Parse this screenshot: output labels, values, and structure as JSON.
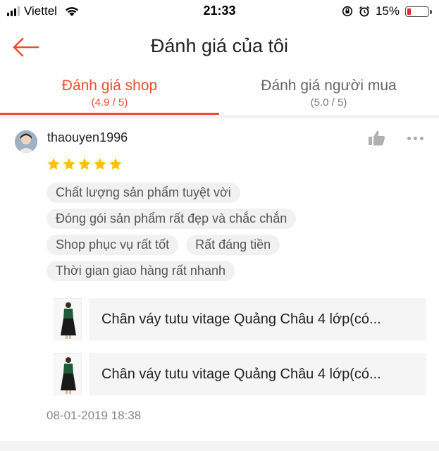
{
  "status_bar": {
    "carrier": "Viettel",
    "time": "21:33",
    "battery_percent": "15%",
    "battery_level": 0.15,
    "icons": [
      "signal-icon",
      "wifi-icon",
      "rotation-lock-icon",
      "alarm-icon",
      "battery-icon"
    ]
  },
  "nav": {
    "title": "Đánh giá của tôi",
    "back_icon": "back-arrow-icon"
  },
  "tabs": [
    {
      "label": "Đánh giá shop",
      "rating": "(4.9 / 5)",
      "active": true
    },
    {
      "label": "Đánh giá người mua",
      "rating": "(5.0 / 5)",
      "active": false
    }
  ],
  "review": {
    "username": "thaouyen1996",
    "stars": 5,
    "tags": [
      [
        "Chất lượng sản phẩm tuyệt vời"
      ],
      [
        "Đóng gói sản phẩm rất đẹp và chắc chắn"
      ],
      [
        "Shop phục vụ rất tốt",
        "Rất đáng tiền"
      ],
      [
        "Thời gian giao hàng rất nhanh"
      ]
    ],
    "products": [
      {
        "name": "Chân váy tutu vitage Quảng Châu 4 lớp(có..."
      },
      {
        "name": "Chân váy tutu vitage Quảng Châu 4 lớp(có..."
      }
    ],
    "timestamp": "08-01-2019 18:38"
  },
  "colors": {
    "accent": "#ee4d2d",
    "star": "#ffc107",
    "battery_low": "#e5262a"
  }
}
